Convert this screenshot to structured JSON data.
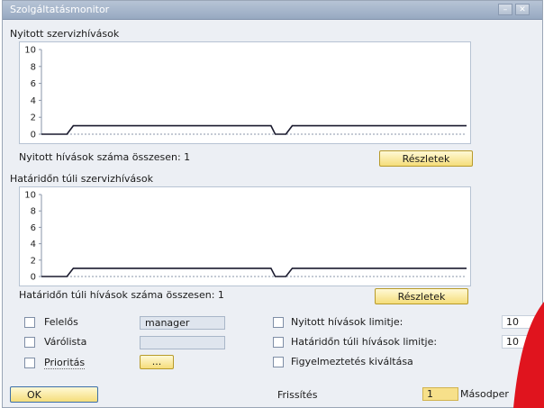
{
  "window": {
    "title": "Szolgáltatásmonitor"
  },
  "section1": {
    "title": "Nyitott szervizhívások",
    "total_label": "Nyitott hívások száma összesen: 1",
    "details_button": "Részletek",
    "chart_data": {
      "type": "line",
      "yticks": [
        "10",
        "8",
        "6",
        "4",
        "2",
        "0"
      ],
      "ylim": [
        0,
        10
      ],
      "series": [
        {
          "segments": [
            [
              [
                0.0,
                0
              ],
              [
                0.06,
                0
              ],
              [
                0.075,
                1
              ],
              [
                0.54,
                1
              ],
              [
                0.55,
                0
              ],
              [
                0.575,
                0
              ],
              [
                0.59,
                1
              ],
              [
                1.0,
                1
              ]
            ]
          ]
        }
      ]
    }
  },
  "section2": {
    "title": "Határidőn túli szervizhívások",
    "total_label": "Határidőn túli hívások száma összesen: 1",
    "details_button": "Részletek",
    "chart_data": {
      "type": "line",
      "yticks": [
        "10",
        "8",
        "6",
        "4",
        "2",
        "0"
      ],
      "ylim": [
        0,
        10
      ],
      "series": [
        {
          "segments": [
            [
              [
                0.0,
                0
              ],
              [
                0.06,
                0
              ],
              [
                0.075,
                1
              ],
              [
                0.54,
                1
              ],
              [
                0.55,
                0
              ],
              [
                0.575,
                0
              ],
              [
                0.59,
                1
              ],
              [
                1.0,
                1
              ]
            ]
          ]
        }
      ]
    }
  },
  "options": {
    "felelos_label": "Felelős",
    "felelos_value": "manager",
    "varolista_label": "Várólista",
    "varolista_value": "",
    "prioritas_label": "Prioritás",
    "prioritas_button": "...",
    "nyitott_limit_label": "Nyitott hívások limitje:",
    "nyitott_limit_value": "10",
    "hatarido_limit_label": "Határidőn túli hívások limitje:",
    "hatarido_limit_value": "10",
    "figyelmeztetes_label": "Figyelmeztetés kiváltása"
  },
  "footer": {
    "ok_button": "OK",
    "frissites_label": "Frissítés",
    "frissites_value": "1",
    "unit": "Másodper"
  },
  "colors": {
    "button_fill": "#f5dd7a",
    "accent": "#e0141e"
  }
}
